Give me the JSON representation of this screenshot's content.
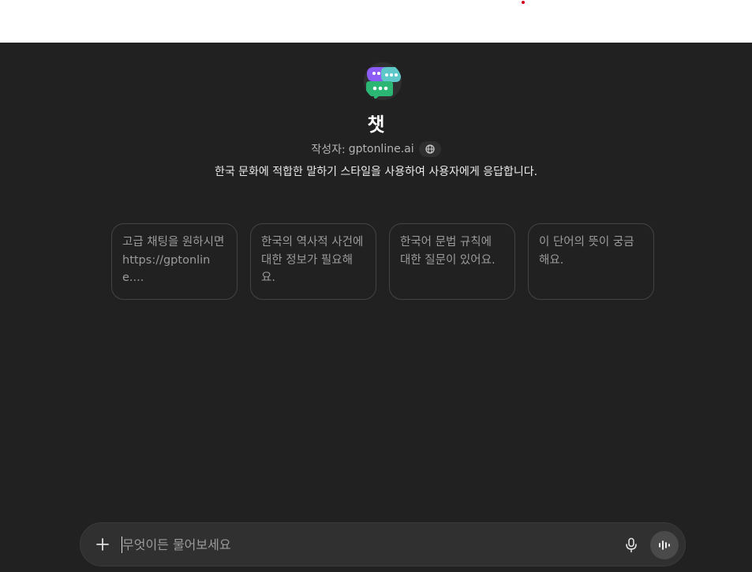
{
  "gpt": {
    "title": "챗",
    "byline_prefix": "작성자:",
    "byline_domain": "gptonline.ai",
    "description": "한국 문화에 적합한 말하기 스타일을 사용하여 사용자에게 응답합니다."
  },
  "starters": [
    {
      "label": "고급 채팅을 원하시면 https://gptonline...."
    },
    {
      "label": "한국의 역사적 사건에 대한 정보가 필요해요."
    },
    {
      "label": "한국어 문법 규칙에 대한 질문이 있어요."
    },
    {
      "label": "이 단어의 뜻이 궁금해요."
    }
  ],
  "composer": {
    "placeholder": "무엇이든 물어보세요",
    "value": ""
  },
  "icons": {
    "plus": "plus-icon",
    "mic": "microphone-icon",
    "voice": "voice-mode-icon",
    "globe": "globe-icon",
    "avatar": "chat-bubbles-avatar"
  },
  "colors": {
    "background": "#212121",
    "composer": "#303030",
    "avatar_green": "#2bb673",
    "avatar_purple": "#8b5cf6",
    "avatar_teal": "#5ec8c9"
  }
}
